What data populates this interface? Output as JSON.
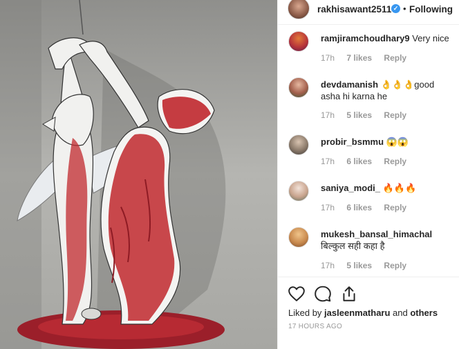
{
  "post": {
    "author": "rakhisawant2511",
    "follow_label": "Following",
    "dot": "•",
    "verified_mark": "✓"
  },
  "comments": [
    {
      "user": "ramjiramchoudhary9",
      "text": " Very nice",
      "age": "17h",
      "likes": "7 likes",
      "reply": "Reply"
    },
    {
      "user": "devdamanish",
      "text": " 👌👌👌good asha hi karna he",
      "age": "17h",
      "likes": "5 likes",
      "reply": "Reply"
    },
    {
      "user": "probir_bsmmu",
      "text": " 😱😱",
      "age": "17h",
      "likes": "6 likes",
      "reply": "Reply"
    },
    {
      "user": "saniya_modi_",
      "text": " 🔥🔥🔥",
      "age": "17h",
      "likes": "6 likes",
      "reply": "Reply"
    },
    {
      "user": "mukesh_bansal_himachal",
      "text": " बिल्कुल सही कहा है",
      "age": "17h",
      "likes": "5 likes",
      "reply": "Reply"
    }
  ],
  "actions": {
    "icons": [
      "heart-icon",
      "comment-icon",
      "share-icon"
    ]
  },
  "likes_line": {
    "prefix": "Liked by ",
    "user": "jasleenmatharu",
    "middle": " and ",
    "others": "others"
  },
  "timestamp": "17 HOURS AGO",
  "colors": {
    "verified": "#3897f0",
    "text": "#262626",
    "muted": "#999999",
    "blood": "#c0282e"
  }
}
